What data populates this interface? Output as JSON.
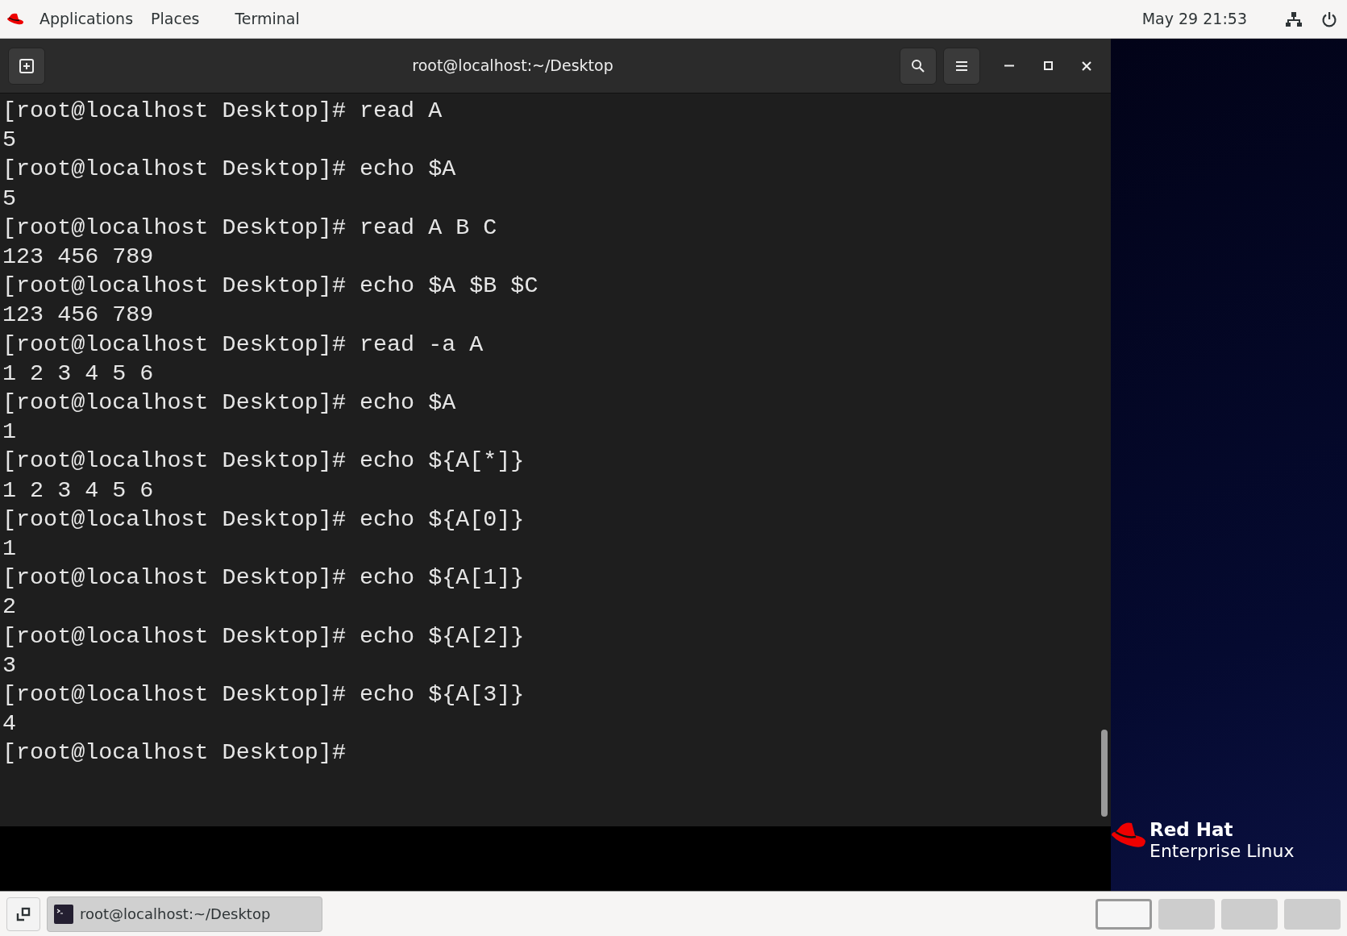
{
  "top_bar": {
    "menus": [
      "Applications",
      "Places",
      "Terminal"
    ],
    "clock": "May 29  21:53"
  },
  "terminal": {
    "title": "root@localhost:~/Desktop",
    "lines": [
      "[root@localhost Desktop]# read A",
      "5",
      "[root@localhost Desktop]# echo $A",
      "5",
      "[root@localhost Desktop]# read A B C",
      "123 456 789",
      "[root@localhost Desktop]# echo $A $B $C",
      "123 456 789",
      "[root@localhost Desktop]# read -a A",
      "1 2 3 4 5 6",
      "[root@localhost Desktop]# echo $A",
      "1",
      "[root@localhost Desktop]# echo ${A[*]}",
      "1 2 3 4 5 6",
      "[root@localhost Desktop]# echo ${A[0]}",
      "1",
      "[root@localhost Desktop]# echo ${A[1]}",
      "2",
      "[root@localhost Desktop]# echo ${A[2]}",
      "3",
      "[root@localhost Desktop]# echo ${A[3]}",
      "4",
      "[root@localhost Desktop]#"
    ]
  },
  "desktop": {
    "logo_line_1": "Red Hat",
    "logo_line_2": "Enterprise Linux"
  },
  "taskbar": {
    "window_button": "root@localhost:~/Desktop",
    "workspaces": [
      {
        "selected": true
      },
      {
        "selected": false
      },
      {
        "selected": false
      },
      {
        "selected": false
      }
    ]
  }
}
